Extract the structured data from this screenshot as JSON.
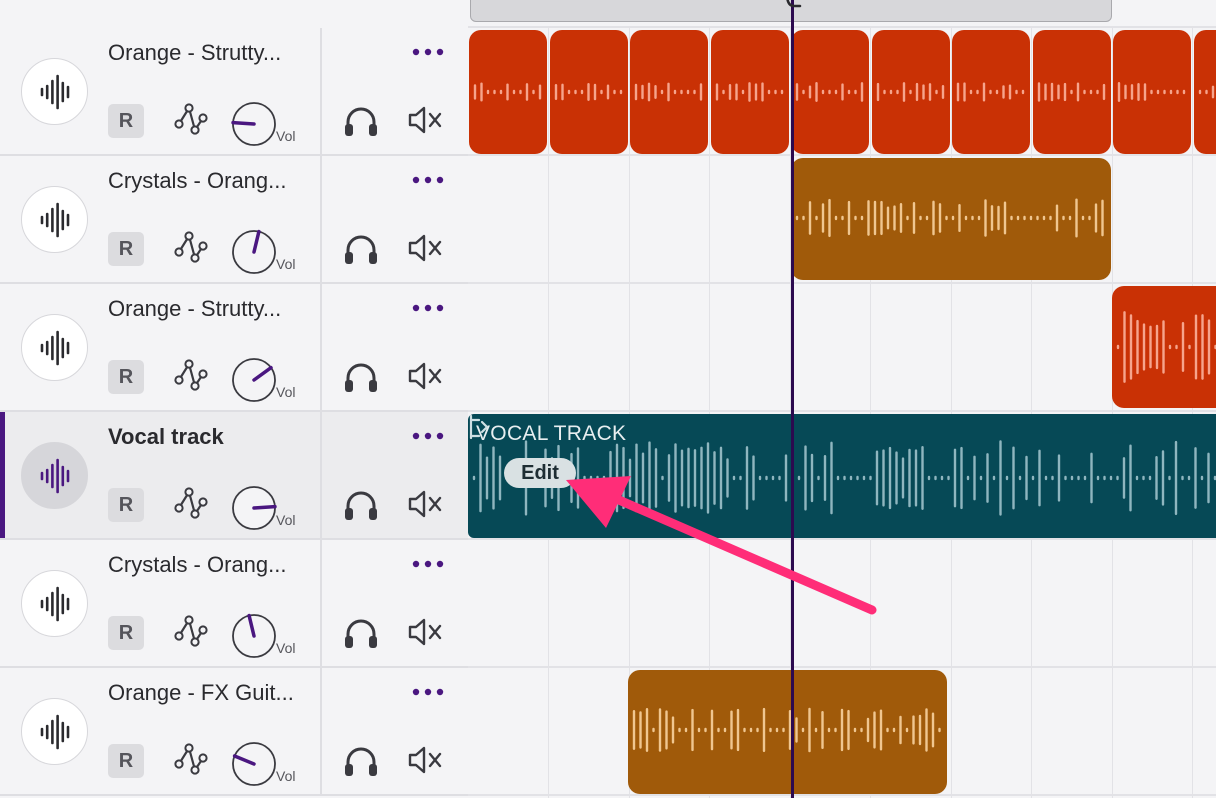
{
  "tracks": [
    {
      "name": "Orange - Strutty...",
      "record_label": "R",
      "vol_label": "Vol",
      "volume": 0.18,
      "selected": false,
      "more_icon": "more-dots-icon"
    },
    {
      "name": "Crystals - Orang...",
      "record_label": "R",
      "vol_label": "Vol",
      "volume": 0.55,
      "selected": false,
      "more_icon": "more-dots-icon"
    },
    {
      "name": "Orange - Strutty...",
      "record_label": "R",
      "vol_label": "Vol",
      "volume": 0.7,
      "selected": false,
      "more_icon": "more-dots-icon"
    },
    {
      "name": "Vocal track",
      "record_label": "R",
      "vol_label": "Vol",
      "volume": 0.82,
      "selected": true,
      "more_icon": "more-dots-icon"
    },
    {
      "name": "Crystals - Orang...",
      "record_label": "R",
      "vol_label": "Vol",
      "volume": 0.45,
      "selected": false,
      "more_icon": "more-dots-icon"
    },
    {
      "name": "Orange - FX Guit...",
      "record_label": "R",
      "vol_label": "Vol",
      "volume": 0.25,
      "selected": false,
      "more_icon": "more-dots-icon"
    }
  ],
  "vocal_clip": {
    "label": "VOCAL TRACK",
    "edit_label": "Edit"
  },
  "colors": {
    "accent": "#4a1780",
    "clip_red": "#c93105",
    "clip_amber": "#a05a0a",
    "clip_teal": "#064956",
    "arrow": "#ff2d78"
  }
}
